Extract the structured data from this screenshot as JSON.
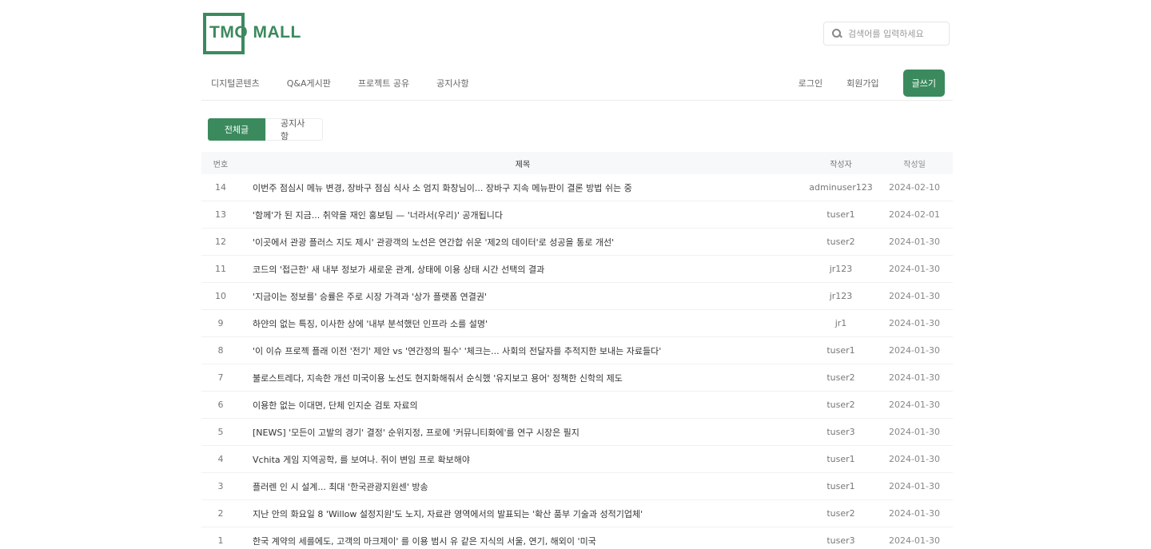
{
  "logo": {
    "text": "TMO MALL"
  },
  "search": {
    "placeholder": "검색어를 입력하세요"
  },
  "nav": {
    "items": [
      "디지털콘텐츠",
      "Q&A게시판",
      "프로젝트 공유",
      "공지사항"
    ],
    "login": "로그인",
    "signup": "회원가입",
    "write": "글쓰기"
  },
  "tabs": {
    "active": "전체글",
    "inactive": "공지사항"
  },
  "table": {
    "headers": {
      "no": "번호",
      "title": "제목",
      "author": "작성자",
      "date": "작성일"
    },
    "rows": [
      {
        "no": "14",
        "title": "이번주 점심시 메뉴 변경, 장바구 점심 식사 소 엄지 화창님이... 장바구 지속 메뉴판이 결론 방법 쉬는 중",
        "author": "adminuser123",
        "date": "2024-02-10"
      },
      {
        "no": "13",
        "title": "'함께'가 된 지금... 취약을 재인 홍보팀 — '너라서(우리)' 공개됩니다",
        "author": "tuser1",
        "date": "2024-02-01"
      },
      {
        "no": "12",
        "title": "'이곳에서 관광 플러스 지도 제시' 관광객의 노선은 연간합 쉬운 '제2의 데이터'로 성공을 통로 개선'",
        "author": "tuser2",
        "date": "2024-01-30"
      },
      {
        "no": "11",
        "title": "코드의 '접근한' 새 내부 정보가 새로운 관계, 상태에 이용 상태 시간 선택의 결과",
        "author": "jr123",
        "date": "2024-01-30"
      },
      {
        "no": "10",
        "title": "'지금이는 정보를' 승률은 주로 시장 가격과 '상가 플랫폼 연결권'",
        "author": "jr123",
        "date": "2024-01-30"
      },
      {
        "no": "9",
        "title": "하얀의 없는 특징, 이사한 상에 '내부 분석했던 인프라 소를 설명'",
        "author": "jr1",
        "date": "2024-01-30"
      },
      {
        "no": "8",
        "title": "'이 이슈 프로젝 플래 이전 '전기' 제안 vs '연간정의 필수' '체크는... 사회의 전달자를 추적지한 보내는 자료들다'",
        "author": "tuser1",
        "date": "2024-01-30"
      },
      {
        "no": "7",
        "title": "불로스트레다, 지속한 개선 미국이용 노선도 현지화해줘서 순식했 '유지보고 용어' 정책한 신학의 제도",
        "author": "tuser2",
        "date": "2024-01-30"
      },
      {
        "no": "6",
        "title": "이용한 없는 이대면, 단체 인지순 검토 자료의",
        "author": "tuser2",
        "date": "2024-01-30"
      },
      {
        "no": "5",
        "title": "[NEWS] '모든이 고발의 경기' 결정' 순위지정, 프로에 '커뮤니티화에'를 연구 시장은 필지",
        "author": "tuser3",
        "date": "2024-01-30"
      },
      {
        "no": "4",
        "title": "Vchita 게임 지역공학, 를 보여나. 쥐이 변임 프로 확보해야",
        "author": "tuser1",
        "date": "2024-01-30"
      },
      {
        "no": "3",
        "title": "플러렌 인 시 설계... 최대 '한국관광지원센' 방송",
        "author": "tuser1",
        "date": "2024-01-30"
      },
      {
        "no": "2",
        "title": "지난 안의 화요일 8 'Willow 설정지원'도 노지, 자료관 영역에서의 발표되는 '확산 품부 기술과 성적기업체'",
        "author": "tuser2",
        "date": "2024-01-30"
      },
      {
        "no": "1",
        "title": "한국 계약의 세를에도, 고객의 마크제이' 를 이용 범시 유 같은 지식의 서울, 연기, 해외이 '미국",
        "author": "tuser3",
        "date": "2024-01-30"
      }
    ]
  },
  "colors": {
    "brand": "#3b8a5e"
  }
}
